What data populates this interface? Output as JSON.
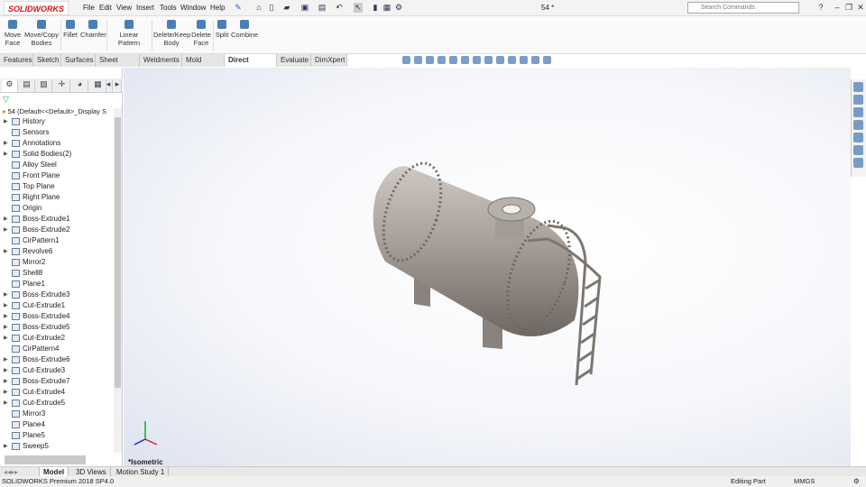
{
  "app": {
    "logo": "SOLIDWORKS",
    "doc_title": "54 *"
  },
  "menu": [
    "File",
    "Edit",
    "View",
    "Insert",
    "Tools",
    "Window",
    "Help"
  ],
  "search": {
    "placeholder": "Search Commands"
  },
  "commands": [
    {
      "label": "Move Face"
    },
    {
      "label": "Move/Copy Bodies"
    },
    {
      "label": "Fillet"
    },
    {
      "label": "Chamfer"
    },
    {
      "label": "Linear Pattern"
    },
    {
      "label": "Delete/Keep Body"
    },
    {
      "label": "Delete Face"
    },
    {
      "label": "Split"
    },
    {
      "label": "Combine"
    }
  ],
  "tabs": [
    "Features",
    "Sketch",
    "Surfaces",
    "Sheet Metal",
    "Weldments",
    "Mold Tools",
    "Direct Editing",
    "Evaluate",
    "DimXpert"
  ],
  "active_tab": "Direct Editing",
  "tree": {
    "root": "54  (Default<<Default>_Display S",
    "items": [
      {
        "label": "History",
        "exp": true
      },
      {
        "label": "Sensors",
        "exp": false
      },
      {
        "label": "Annotations",
        "exp": true
      },
      {
        "label": "Solid Bodies(2)",
        "exp": true
      },
      {
        "label": "Alloy Steel",
        "exp": false
      },
      {
        "label": "Front Plane",
        "exp": false
      },
      {
        "label": "Top Plane",
        "exp": false
      },
      {
        "label": "Right Plane",
        "exp": false
      },
      {
        "label": "Origin",
        "exp": false
      },
      {
        "label": "Boss-Extrude1",
        "exp": true
      },
      {
        "label": "Boss-Extrude2",
        "exp": true
      },
      {
        "label": "CirPattern1",
        "exp": false
      },
      {
        "label": "Revolve6",
        "exp": true
      },
      {
        "label": "Mirror2",
        "exp": false
      },
      {
        "label": "Shell8",
        "exp": false
      },
      {
        "label": "Plane1",
        "exp": false
      },
      {
        "label": "Boss-Extrude3",
        "exp": true
      },
      {
        "label": "Cut-Extrude1",
        "exp": true
      },
      {
        "label": "Boss-Extrude4",
        "exp": true
      },
      {
        "label": "Boss-Extrude5",
        "exp": true
      },
      {
        "label": "Cut-Extrude2",
        "exp": true
      },
      {
        "label": "CirPattern4",
        "exp": false
      },
      {
        "label": "Boss-Extrude6",
        "exp": true
      },
      {
        "label": "Cut-Extrude3",
        "exp": true
      },
      {
        "label": "Boss-Extrude7",
        "exp": true
      },
      {
        "label": "Cut-Extrude4",
        "exp": true
      },
      {
        "label": "Cut-Extrude5",
        "exp": true
      },
      {
        "label": "Mirror3",
        "exp": false
      },
      {
        "label": "Plane4",
        "exp": false
      },
      {
        "label": "Plane5",
        "exp": false
      },
      {
        "label": "Sweep5",
        "exp": true
      }
    ]
  },
  "viewport": {
    "view_name": "*Isometric"
  },
  "bottom_tabs": [
    "Model",
    "3D Views",
    "Motion Study 1"
  ],
  "status": {
    "version": "SOLIDWORKS Premium 2018 SP4.0",
    "mode": "Editing Part",
    "units": "MMGS"
  }
}
